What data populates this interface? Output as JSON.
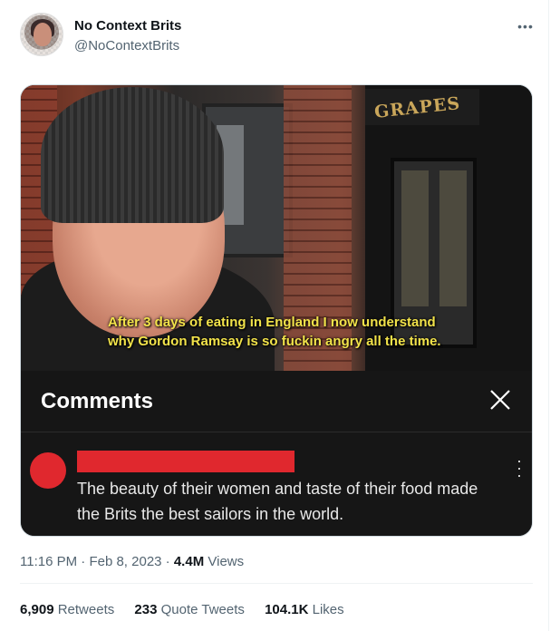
{
  "author": {
    "display_name": "No Context Brits",
    "handle": "@NoContextBrits"
  },
  "media": {
    "sign_text": "GRAPES",
    "caption_line1": "After 3 days of eating in England I now understand",
    "caption_line2": "why Gordon Ramsay is so fuckin angry all the time.",
    "comments_panel": {
      "title": "Comments",
      "comment_text": "The beauty of their women and taste of their food made the Brits the best sailors in the world."
    }
  },
  "meta": {
    "time": "11:16 PM",
    "separator": "·",
    "date": "Feb 8, 2023",
    "views_count": "4.4M",
    "views_label": "Views"
  },
  "stats": {
    "retweets_count": "6,909",
    "retweets_label": "Retweets",
    "quote_count": "233",
    "quote_label": "Quote Tweets",
    "likes_count": "104.1K",
    "likes_label": "Likes"
  },
  "colors": {
    "text_primary": "#0f1419",
    "text_secondary": "#536471",
    "caption_yellow": "#f2e34a",
    "redaction_red": "#e0282e",
    "panel_dark": "#161616"
  },
  "icons": {
    "more": "more-horizontal-icon",
    "close": "close-x-icon",
    "comment_more": "more-vertical-icon"
  }
}
